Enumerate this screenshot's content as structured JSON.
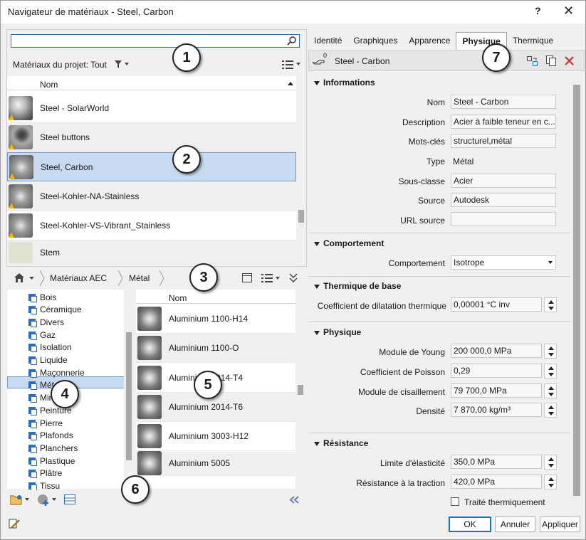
{
  "window": {
    "title": "Navigateur de matériaux - Steel, Carbon",
    "help": "?",
    "close": "✕"
  },
  "search": {
    "value": "",
    "placeholder": ""
  },
  "project": {
    "label": "Matériaux du projet: Tout"
  },
  "list": {
    "header": "Nom",
    "items": [
      {
        "name": "Steel - SolarWorld",
        "thumb": "sphere",
        "selected": false
      },
      {
        "name": "Steel buttons",
        "thumb": "sphere",
        "selected": false
      },
      {
        "name": "Steel, Carbon",
        "thumb": "chip",
        "selected": true
      },
      {
        "name": "Steel-Kohler-NA-Stainless",
        "thumb": "chip",
        "selected": false
      },
      {
        "name": "Steel-Kohler-VS-Vibrant_Stainless",
        "thumb": "chip",
        "selected": false
      },
      {
        "name": "Stem",
        "thumb": "stone",
        "selected": false
      }
    ]
  },
  "breadcrumb": {
    "home": "home-icon",
    "items": [
      "Matériaux AEC",
      "Métal"
    ]
  },
  "tree": {
    "items": [
      "Bois",
      "Céramique",
      "Divers",
      "Gaz",
      "Isolation",
      "Liquide",
      "Maçonnerie",
      "Métal",
      "Miroir",
      "Peinture",
      "Pierre",
      "Plafonds",
      "Planchers",
      "Plastique",
      "Plâtre",
      "Tissu"
    ],
    "selected_index": 7
  },
  "library": {
    "header": "Nom",
    "items": [
      "Aluminium 1100-H14",
      "Aluminium 1100-O",
      "Aluminium 2014-T4",
      "Aluminium 2014-T6",
      "Aluminium 3003-H12",
      "Aluminium 5005"
    ]
  },
  "callouts": [
    "1",
    "2",
    "3",
    "4",
    "5",
    "6",
    "7"
  ],
  "tabs": [
    "Identité",
    "Graphiques",
    "Apparence",
    "Physique",
    "Thermique"
  ],
  "active_tab": "Physique",
  "asset": {
    "name": "Steel - Carbon",
    "user_count": "0"
  },
  "sections": {
    "informations": {
      "title": "Informations",
      "nom_label": "Nom",
      "nom": "Steel - Carbon",
      "desc_label": "Description",
      "desc": "Acier à faible teneur en c...",
      "mots_label": "Mots-clés",
      "mots": "structurel,métal",
      "type_label": "Type",
      "type": "Métal",
      "sous_label": "Sous-classe",
      "sous": "Acier",
      "source_label": "Source",
      "source": "Autodesk",
      "url_label": "URL source",
      "url": ""
    },
    "comportement": {
      "title": "Comportement",
      "label": "Comportement",
      "value": "Isotrope"
    },
    "thermique": {
      "title": "Thermique de base",
      "label": "Coefficient de dilatation thermique",
      "value": "0,00001 °C inv"
    },
    "physique": {
      "title": "Physique",
      "young_label": "Module de Young",
      "young": "200 000,0 MPa",
      "poisson_label": "Coefficient de Poisson",
      "poisson": "0,29",
      "cis_label": "Module de cisaillement",
      "cis": "79 700,0 MPa",
      "dens_label": "Densité",
      "dens": "7 870,00 kg/m³"
    },
    "resistance": {
      "title": "Résistance",
      "elast_label": "Limite d'élasticité",
      "elast": "350,0 MPa",
      "trac_label": "Résistance à la traction",
      "trac": "420,0 MPa",
      "traite_label": "Traité thermiquement",
      "traite": false
    }
  },
  "buttons": {
    "ok": "OK",
    "cancel": "Annuler",
    "apply": "Appliquer"
  },
  "colors": {
    "accent": "#0078d4",
    "selection": "#c8daf0",
    "delete": "#d03030"
  }
}
